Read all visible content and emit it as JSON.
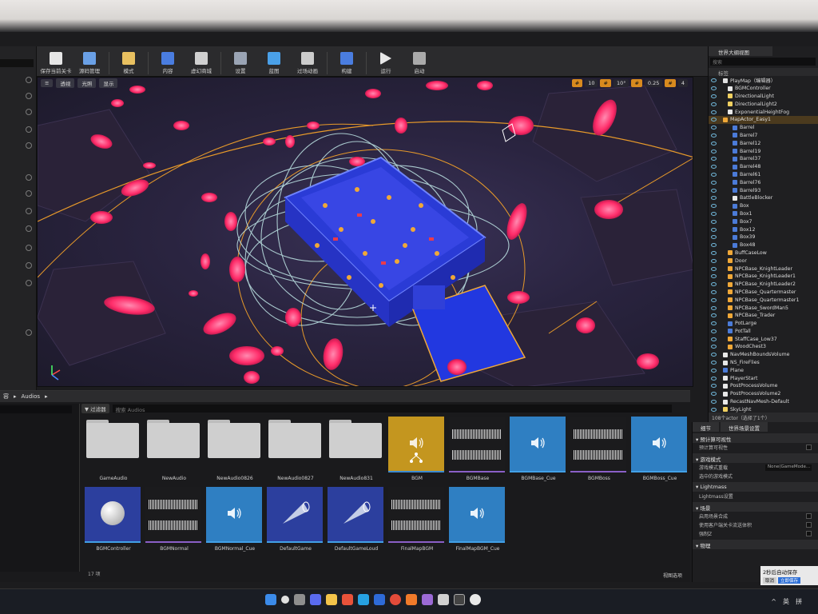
{
  "toolbar": {
    "buttons": [
      {
        "label": "保存当前关卡",
        "icon": "save-icon"
      },
      {
        "label": "源码管理",
        "icon": "source-control-icon"
      },
      {
        "label": "模式",
        "icon": "modes-icon"
      },
      {
        "label": "内容",
        "icon": "content-icon"
      },
      {
        "label": "虚幻商城",
        "icon": "marketplace-icon"
      },
      {
        "label": "设置",
        "icon": "settings-icon"
      },
      {
        "label": "蓝图",
        "icon": "blueprint-icon"
      },
      {
        "label": "过场动画",
        "icon": "cinematics-icon"
      },
      {
        "label": "构建",
        "icon": "build-icon"
      },
      {
        "label": "运行",
        "icon": "play-icon"
      },
      {
        "label": "启动",
        "icon": "launch-icon"
      }
    ]
  },
  "viewport": {
    "chips": [
      "透视",
      "光照",
      "显示"
    ],
    "right_controls": [
      "10",
      "10°",
      "0.25",
      "4"
    ]
  },
  "outliner": {
    "tab": "世界大纲视图",
    "search_placeholder": "搜索",
    "header": "标签",
    "items": [
      {
        "label": "PlayMap（编辑器）",
        "indent": 1,
        "color": "#e0e0e0"
      },
      {
        "label": "BGMController",
        "indent": 2,
        "color": "#e8e8e8"
      },
      {
        "label": "DirectionalLight",
        "indent": 2,
        "color": "#f0d060"
      },
      {
        "label": "DirectionalLight2",
        "indent": 2,
        "color": "#f0d060"
      },
      {
        "label": "ExponentialHeightFog",
        "indent": 2,
        "color": "#e8e8e8"
      },
      {
        "label": "MapActor_Easy1",
        "indent": 1,
        "color": "#f0a838",
        "selected": true
      },
      {
        "label": "Barrel",
        "indent": 3,
        "color": "#4b7bd8"
      },
      {
        "label": "Barrel7",
        "indent": 3,
        "color": "#4b7bd8"
      },
      {
        "label": "Barrel12",
        "indent": 3,
        "color": "#4b7bd8"
      },
      {
        "label": "Barrel19",
        "indent": 3,
        "color": "#4b7bd8"
      },
      {
        "label": "Barrel37",
        "indent": 3,
        "color": "#4b7bd8"
      },
      {
        "label": "Barrel48",
        "indent": 3,
        "color": "#4b7bd8"
      },
      {
        "label": "Barrel61",
        "indent": 3,
        "color": "#4b7bd8"
      },
      {
        "label": "Barrel76",
        "indent": 3,
        "color": "#4b7bd8"
      },
      {
        "label": "Barrel93",
        "indent": 3,
        "color": "#4b7bd8"
      },
      {
        "label": "BattleBlocker",
        "indent": 3,
        "color": "#e8e8e8"
      },
      {
        "label": "Box",
        "indent": 3,
        "color": "#4b7bd8"
      },
      {
        "label": "Box1",
        "indent": 3,
        "color": "#4b7bd8"
      },
      {
        "label": "Box7",
        "indent": 3,
        "color": "#4b7bd8"
      },
      {
        "label": "Box12",
        "indent": 3,
        "color": "#4b7bd8"
      },
      {
        "label": "Box39",
        "indent": 3,
        "color": "#4b7bd8"
      },
      {
        "label": "Box48",
        "indent": 3,
        "color": "#4b7bd8"
      },
      {
        "label": "BuffCaseLow",
        "indent": 2,
        "color": "#f0a838"
      },
      {
        "label": "Door",
        "indent": 2,
        "color": "#f0a838"
      },
      {
        "label": "NPCBase_KnightLeader",
        "indent": 2,
        "color": "#f0a838"
      },
      {
        "label": "NPCBase_KnightLeader1",
        "indent": 2,
        "color": "#f0a838"
      },
      {
        "label": "NPCBase_KnightLeader2",
        "indent": 2,
        "color": "#f0a838"
      },
      {
        "label": "NPCBase_Quartermaster",
        "indent": 2,
        "color": "#f0a838"
      },
      {
        "label": "NPCBase_Quartermaster1",
        "indent": 2,
        "color": "#f0a838"
      },
      {
        "label": "NPCBase_SwordMan5",
        "indent": 2,
        "color": "#f0a838"
      },
      {
        "label": "NPCBase_Trader",
        "indent": 2,
        "color": "#f0a838"
      },
      {
        "label": "PotLarge",
        "indent": 2,
        "color": "#4b7bd8"
      },
      {
        "label": "PotTall",
        "indent": 2,
        "color": "#4b7bd8"
      },
      {
        "label": "StaffCase_Low37",
        "indent": 2,
        "color": "#f0a838"
      },
      {
        "label": "WoodChest3",
        "indent": 2,
        "color": "#f0a838"
      },
      {
        "label": "NavMeshBoundsVolume",
        "indent": 1,
        "color": "#e8e8e8"
      },
      {
        "label": "NS_FireFlies",
        "indent": 1,
        "color": "#e8e8e8"
      },
      {
        "label": "Plane",
        "indent": 1,
        "color": "#4b7bd8"
      },
      {
        "label": "PlayerStart",
        "indent": 1,
        "color": "#e8e8e8"
      },
      {
        "label": "PostProcessVolume",
        "indent": 1,
        "color": "#e8e8e8"
      },
      {
        "label": "PostProcessVolume2",
        "indent": 1,
        "color": "#e8e8e8"
      },
      {
        "label": "RecastNavMesh-Default",
        "indent": 1,
        "color": "#e8e8e8"
      },
      {
        "label": "SkyLight",
        "indent": 1,
        "color": "#f0d060"
      }
    ],
    "footer": "108个actor（选择了1个）"
  },
  "content_browser": {
    "path_root": "容",
    "path_folder": "Audios",
    "filter_label": "过滤器",
    "search_placeholder": "搜索 Audios",
    "assets": [
      {
        "name": "GameAudio",
        "type": "folder"
      },
      {
        "name": "NewAudio",
        "type": "folder"
      },
      {
        "name": "NewAudio0826",
        "type": "folder"
      },
      {
        "name": "NewAudio0827",
        "type": "folder"
      },
      {
        "name": "NewAudio831",
        "type": "folder"
      },
      {
        "name": "BGM",
        "type": "gold"
      },
      {
        "name": "BGMBase",
        "type": "wave"
      },
      {
        "name": "BGMBase_Cue",
        "type": "blue"
      },
      {
        "name": "BGMBoss",
        "type": "wave"
      },
      {
        "name": "BGMBoss_Cue",
        "type": "blue"
      },
      {
        "name": "BGMController",
        "type": "navy-sphere"
      },
      {
        "name": "BGMNormal",
        "type": "wave"
      },
      {
        "name": "BGMNormal_Cue",
        "type": "blue"
      },
      {
        "name": "DefaultGame",
        "type": "navy-cone"
      },
      {
        "name": "DefaultGameLoud",
        "type": "navy-cone"
      },
      {
        "name": "FinalMapBGM",
        "type": "wave"
      },
      {
        "name": "FinalMapBGM_Cue",
        "type": "blue"
      }
    ],
    "count": "17 项",
    "view_options": "视图选项"
  },
  "details": {
    "tabs": [
      "细节",
      "世界场景设置"
    ],
    "sections": [
      {
        "title": "预计算可视性",
        "rows": [
          {
            "label": "预计算可视性",
            "control": "checkbox"
          }
        ]
      },
      {
        "title": "游戏模式",
        "rows": [
          {
            "label": "游戏模式重载",
            "control": "select",
            "value": "None(GameMode..."
          },
          {
            "label": "选中的游戏模式",
            "control": "none"
          }
        ]
      },
      {
        "title": "Lightmass",
        "rows": [
          {
            "label": "Lightmass设置",
            "control": "none"
          }
        ]
      },
      {
        "title": "场景",
        "rows": [
          {
            "label": "启用场景合成",
            "control": "checkbox"
          },
          {
            "label": "使用客户端关卡流送体积",
            "control": "checkbox"
          },
          {
            "label": "强制Z",
            "control": "checkbox"
          }
        ]
      },
      {
        "title": "物理",
        "rows": []
      }
    ]
  },
  "toast": {
    "message": "2秒后自动保存",
    "cancel": "取消",
    "save_now": "立即保存"
  },
  "taskbar": {
    "tray_lang": "英",
    "tray_ime": "拼"
  }
}
